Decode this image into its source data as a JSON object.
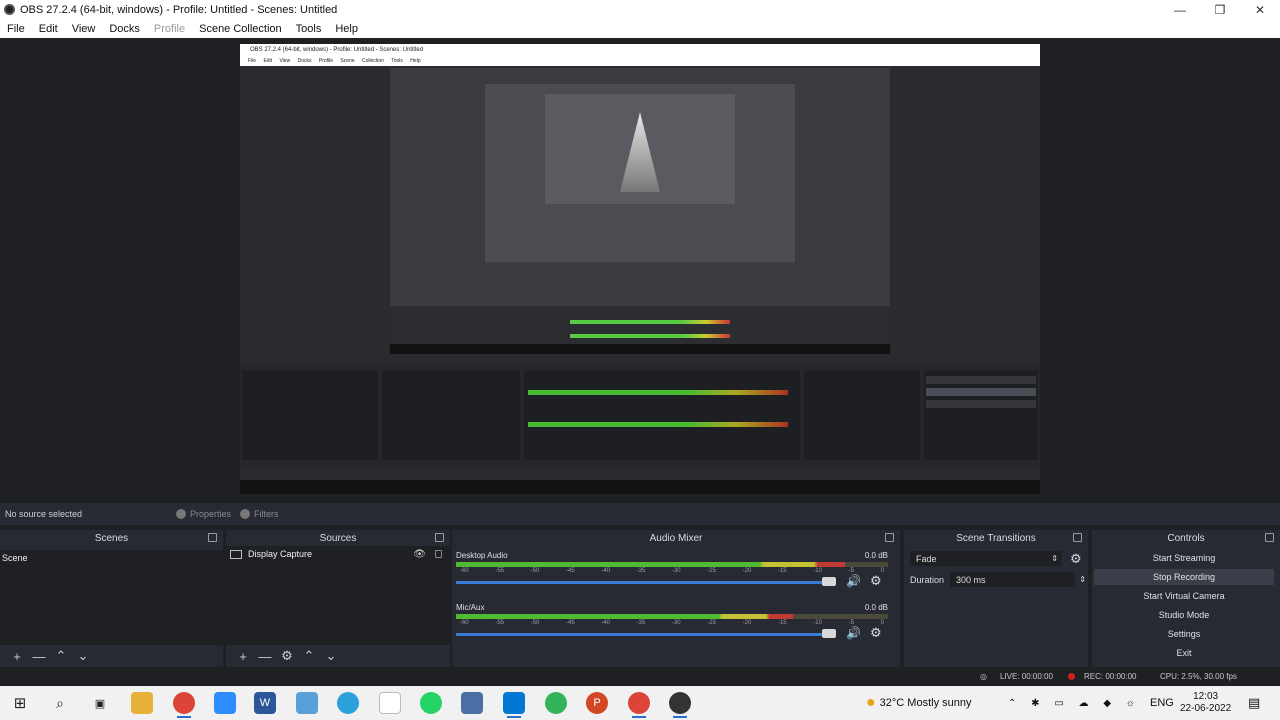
{
  "window": {
    "title": "OBS 27.2.4 (64-bit, windows) - Profile: Untitled - Scenes: Untitled",
    "controls": [
      "—",
      "❐",
      "✕"
    ]
  },
  "menu": {
    "items": [
      "File",
      "Edit",
      "View",
      "Docks",
      "Profile",
      "Scene Collection",
      "Tools",
      "Help"
    ]
  },
  "preview_nested": {
    "title": "OBS 27.2.4 (64-bit, windows) - Profile: Untitled - Scenes: Untitled",
    "menu": "File Edit View Docks Profile Scene Collection Tools Help"
  },
  "source_toolbar": {
    "no_source": "No source selected",
    "properties": "Properties",
    "filters": "Filters"
  },
  "scenes": {
    "header": "Scenes",
    "items": [
      "Scene"
    ],
    "footer": [
      "+",
      "—",
      "⌃",
      "⌄"
    ]
  },
  "sources": {
    "header": "Sources",
    "items": [
      "Display Capture"
    ],
    "footer": [
      "+",
      "—",
      "⚙",
      "⌃",
      "⌄"
    ]
  },
  "mixer": {
    "header": "Audio Mixer",
    "scale": [
      "-60",
      "-55",
      "-50",
      "-45",
      "-40",
      "-35",
      "-30",
      "-25",
      "-20",
      "-15",
      "-10",
      "-5",
      "0"
    ],
    "channels": [
      {
        "name": "Desktop Audio",
        "db": "0.0 dB",
        "level": 0.9,
        "volume": 1.0
      },
      {
        "name": "Mic/Aux",
        "db": "0.0 dB",
        "level": 0.78,
        "volume": 1.0
      }
    ]
  },
  "transitions": {
    "header": "Scene Transitions",
    "selected": "Fade",
    "duration_label": "Duration",
    "duration_value": "300 ms"
  },
  "controls": {
    "header": "Controls",
    "buttons": [
      "Start Streaming",
      "Stop Recording",
      "Start Virtual Camera",
      "Studio Mode",
      "Settings",
      "Exit"
    ]
  },
  "status": {
    "live": "LIVE: 00:00:00",
    "rec": "REC: 00:00:00",
    "cpu": "CPU: 2.5%, 30.00 fps"
  },
  "taskbar": {
    "weather": "32°C  Mostly sunny",
    "lang": "ENG",
    "time": "12:03",
    "date": "22-06-2022"
  },
  "colors": {
    "panel": "#272a33",
    "background": "#1f2023",
    "meter_green": "#4fbb33",
    "meter_yellow": "#c2c233",
    "meter_red": "#c23a33",
    "slider_blue": "#3a7bd5"
  }
}
